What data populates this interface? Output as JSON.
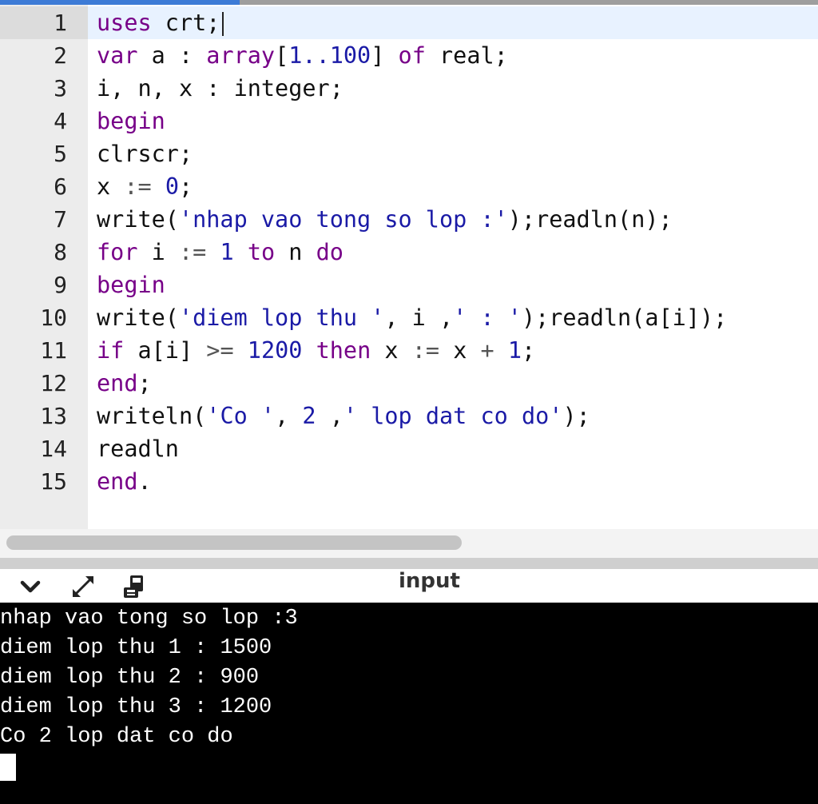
{
  "editor": {
    "lines": [
      {
        "num": "1",
        "tokens": [
          [
            "kw",
            "uses"
          ],
          [
            "t",
            " crt;"
          ]
        ]
      },
      {
        "num": "2",
        "tokens": [
          [
            "kw",
            "var"
          ],
          [
            "t",
            " a : "
          ],
          [
            "kw",
            "array"
          ],
          [
            "t",
            "["
          ],
          [
            "num",
            "1..100"
          ],
          [
            "t",
            "] "
          ],
          [
            "kw",
            "of"
          ],
          [
            "t",
            " real;"
          ]
        ]
      },
      {
        "num": "3",
        "tokens": [
          [
            "t",
            "i, n, x : integer;"
          ]
        ]
      },
      {
        "num": "4",
        "tokens": [
          [
            "kw",
            "begin"
          ]
        ]
      },
      {
        "num": "5",
        "tokens": [
          [
            "t",
            "clrscr;"
          ]
        ]
      },
      {
        "num": "6",
        "tokens": [
          [
            "t",
            "x "
          ],
          [
            "op",
            ":="
          ],
          [
            "t",
            " "
          ],
          [
            "num",
            "0"
          ],
          [
            "t",
            ";"
          ]
        ]
      },
      {
        "num": "7",
        "tokens": [
          [
            "t",
            "write("
          ],
          [
            "str",
            "'nhap vao tong so lop :'"
          ],
          [
            "t",
            ");readln(n);"
          ]
        ]
      },
      {
        "num": "8",
        "tokens": [
          [
            "kw",
            "for"
          ],
          [
            "t",
            " i "
          ],
          [
            "op",
            ":="
          ],
          [
            "t",
            " "
          ],
          [
            "num",
            "1"
          ],
          [
            "t",
            " "
          ],
          [
            "kw",
            "to"
          ],
          [
            "t",
            " n "
          ],
          [
            "kw",
            "do"
          ]
        ]
      },
      {
        "num": "9",
        "tokens": [
          [
            "kw",
            "begin"
          ]
        ]
      },
      {
        "num": "10",
        "tokens": [
          [
            "t",
            "write("
          ],
          [
            "str",
            "'diem lop thu '"
          ],
          [
            "t",
            ", i ,"
          ],
          [
            "str",
            "' : '"
          ],
          [
            "t",
            ");readln(a[i]);"
          ]
        ]
      },
      {
        "num": "11",
        "tokens": [
          [
            "kw",
            "if"
          ],
          [
            "t",
            " a[i] "
          ],
          [
            "op",
            ">="
          ],
          [
            "t",
            " "
          ],
          [
            "num",
            "1200"
          ],
          [
            "t",
            " "
          ],
          [
            "kw",
            "then"
          ],
          [
            "t",
            " x "
          ],
          [
            "op",
            ":="
          ],
          [
            "t",
            " x "
          ],
          [
            "op",
            "+"
          ],
          [
            "t",
            " "
          ],
          [
            "num",
            "1"
          ],
          [
            "t",
            ";"
          ]
        ]
      },
      {
        "num": "12",
        "tokens": [
          [
            "kw",
            "end"
          ],
          [
            "t",
            ";"
          ]
        ]
      },
      {
        "num": "13",
        "tokens": [
          [
            "t",
            "writeln("
          ],
          [
            "str",
            "'Co '"
          ],
          [
            "t",
            ", "
          ],
          [
            "num",
            "2"
          ],
          [
            "t",
            " ,"
          ],
          [
            "str",
            "' lop dat co do'"
          ],
          [
            "t",
            ");"
          ]
        ]
      },
      {
        "num": "14",
        "tokens": [
          [
            "t",
            "readln"
          ]
        ]
      },
      {
        "num": "15",
        "tokens": [
          [
            "kw",
            "end"
          ],
          [
            "t",
            "."
          ]
        ]
      }
    ],
    "colors": {
      "keyword": "#770088",
      "number": "#1a1aa6",
      "string": "#1a1aa6"
    }
  },
  "panel": {
    "title": "input",
    "icons": [
      "chevron-down-icon",
      "expand-arrows-icon",
      "clear-console-icon"
    ]
  },
  "console": {
    "lines": [
      "nhap vao tong so lop :3",
      "diem lop thu 1 : 1500",
      "diem lop thu 2 : 900",
      "diem lop thu 3 : 1200",
      "Co 2 lop dat co do"
    ]
  }
}
